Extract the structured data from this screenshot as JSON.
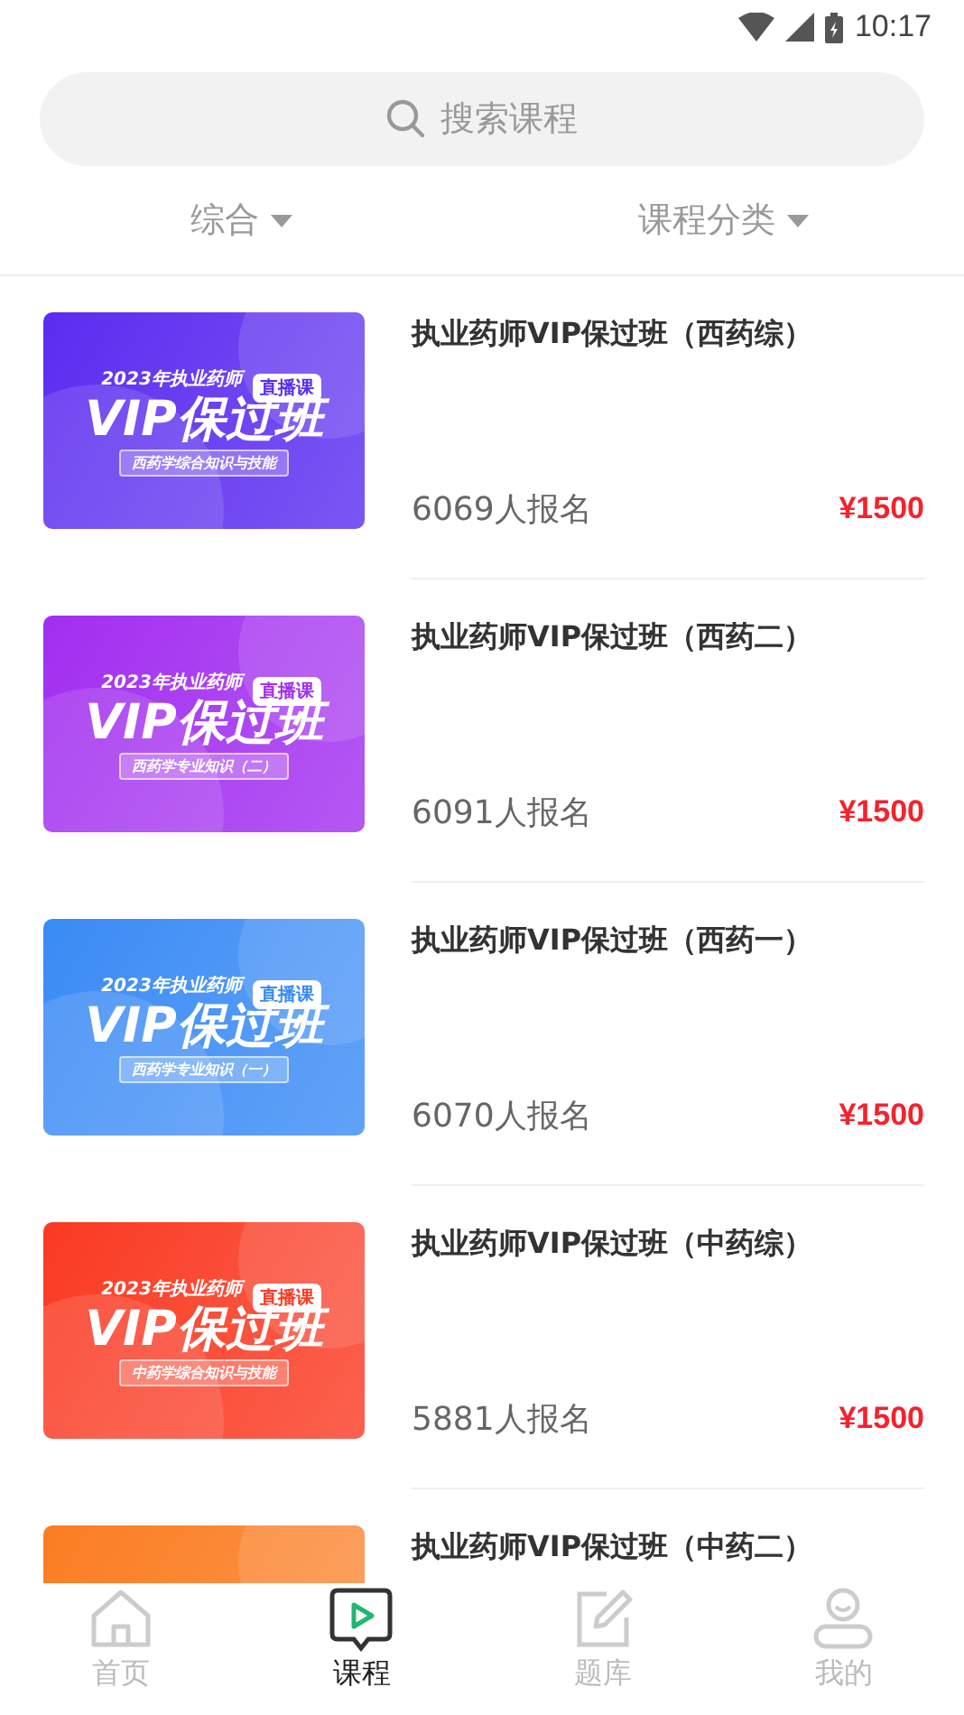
{
  "status_bar": {
    "time": "10:17"
  },
  "search": {
    "placeholder": "搜索课程"
  },
  "filters": [
    {
      "label": "综合"
    },
    {
      "label": "课程分类"
    }
  ],
  "courses": [
    {
      "title": "执业药师VIP保过班（西药综）",
      "enrolled": "6069人报名",
      "price": "¥1500",
      "thumbnail": {
        "color": "#5b2cf0",
        "year_line": "2023年执业药师",
        "badge": "直播课",
        "headline": "VIP保过班",
        "subtitle": "西药学综合知识与技能"
      }
    },
    {
      "title": "执业药师VIP保过班（西药二）",
      "enrolled": "6091人报名",
      "price": "¥1500",
      "thumbnail": {
        "color": "#a22ef0",
        "year_line": "2023年执业药师",
        "badge": "直播课",
        "headline": "VIP保过班",
        "subtitle": "西药学专业知识（二）"
      }
    },
    {
      "title": "执业药师VIP保过班（西药一）",
      "enrolled": "6070人报名",
      "price": "¥1500",
      "thumbnail": {
        "color": "#3a8bf5",
        "year_line": "2023年执业药师",
        "badge": "直播课",
        "headline": "VIP保过班",
        "subtitle": "西药学专业知识（一）"
      }
    },
    {
      "title": "执业药师VIP保过班（中药综）",
      "enrolled": "5881人报名",
      "price": "¥1500",
      "thumbnail": {
        "color": "#fa3a22",
        "year_line": "2023年执业药师",
        "badge": "直播课",
        "headline": "VIP保过班",
        "subtitle": "中药学综合知识与技能"
      }
    },
    {
      "title": "执业药师VIP保过班（中药二）",
      "thumbnail": {
        "color": "#fb7d22"
      }
    }
  ],
  "tabs": [
    {
      "label": "首页",
      "kind": "home",
      "selected": false
    },
    {
      "label": "课程",
      "kind": "play",
      "selected": true
    },
    {
      "label": "题库",
      "kind": "edit",
      "selected": false
    },
    {
      "label": "我的",
      "kind": "user",
      "selected": false
    }
  ]
}
